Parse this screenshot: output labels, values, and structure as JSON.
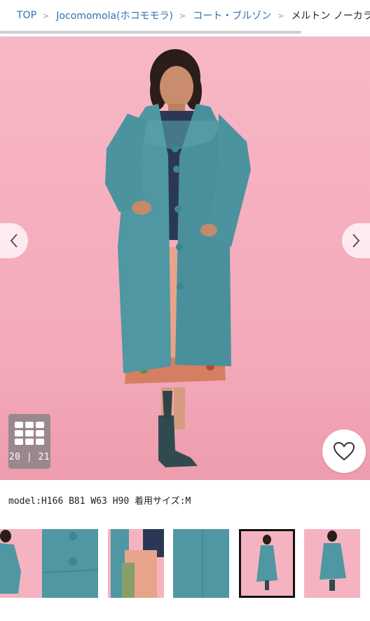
{
  "breadcrumb": {
    "items": [
      "TOP",
      "Jocomomola(ホコモモラ)",
      "コート・ブルゾン"
    ],
    "current": "メルトン ノーカラ",
    "separator": ">"
  },
  "gallery": {
    "counter": "20 | 21",
    "prev_icon": "chevron-left-icon",
    "next_icon": "chevron-right-icon",
    "grid_icon": "grid-icon",
    "favorite_icon": "heart-icon"
  },
  "product": {
    "model_info": "model:H166 B81 W63 H90 着用サイズ:M"
  },
  "thumbnails": [
    {
      "label": "model-front-left"
    },
    {
      "label": "button-detail"
    },
    {
      "label": "skirt-detail"
    },
    {
      "label": "fabric-detail"
    },
    {
      "label": "full-body-selected",
      "selected": true
    },
    {
      "label": "full-body-pose"
    }
  ],
  "colors": {
    "link": "#2f6fb3",
    "coat": "#4f97a3",
    "background_pink": "#f5aebe"
  }
}
